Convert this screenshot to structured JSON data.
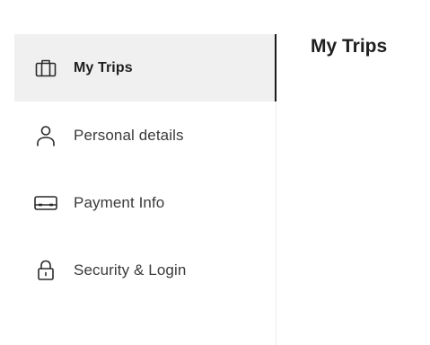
{
  "sidebar": {
    "items": [
      {
        "label": "My Trips",
        "icon": "briefcase-icon",
        "active": true
      },
      {
        "label": "Personal details",
        "icon": "person-icon",
        "active": false
      },
      {
        "label": "Payment Info",
        "icon": "credit-card-icon",
        "active": false
      },
      {
        "label": "Security & Login",
        "icon": "lock-icon",
        "active": false
      }
    ]
  },
  "main": {
    "title": "My Trips"
  },
  "colors": {
    "active_background": "#f0f0f0",
    "active_indicator": "#1a1a1a",
    "text": "#3a3a3a"
  }
}
